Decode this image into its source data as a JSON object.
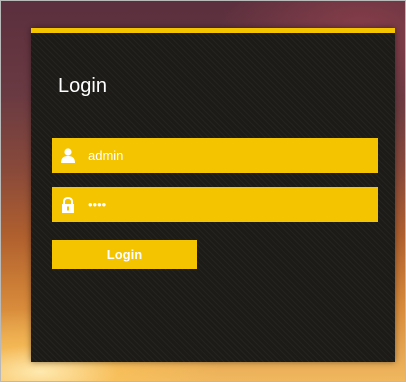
{
  "login": {
    "title": "Login",
    "username": {
      "value": "admin",
      "icon": "user-icon"
    },
    "password": {
      "value": "••••",
      "icon": "lock-icon"
    },
    "button_label": "Login"
  },
  "colors": {
    "accent": "#f4c400",
    "panel_bg": "#1d1b18",
    "text": "#ffffff"
  }
}
